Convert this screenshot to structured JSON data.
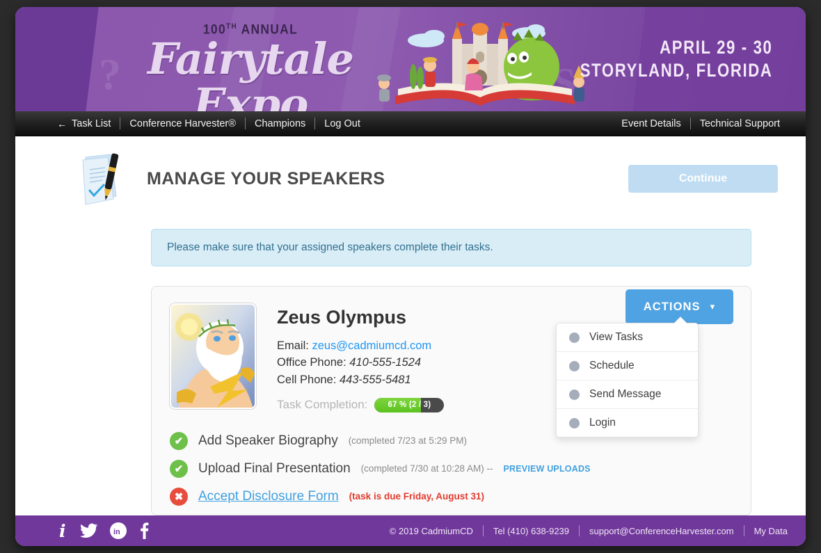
{
  "banner": {
    "annual": "100",
    "annual_sup": "TH",
    "annual_word": "ANNUAL",
    "expo_name": "Fairytale Expo",
    "dates": "APRIL 29 - 30",
    "location": "STORYLAND, FLORIDA",
    "colors": {
      "dark_purple": "#6b3a96",
      "light_purple": "#8e5bb0"
    }
  },
  "nav": {
    "back_arrow": "←",
    "left": [
      {
        "label": "Task List"
      },
      {
        "label": "Conference Harvester®"
      },
      {
        "label": "Champions"
      },
      {
        "label": "Log Out"
      }
    ],
    "right": [
      {
        "label": "Event Details"
      },
      {
        "label": "Technical Support"
      }
    ]
  },
  "header": {
    "title": "MANAGE YOUR SPEAKERS",
    "continue_label": "Continue",
    "continue_color": "#bfdcf2",
    "doc_icon": "document-pen-icon"
  },
  "alert": {
    "message": "Please make sure that your assigned speakers complete their tasks."
  },
  "speaker": {
    "avatar_alt": "zeus-avatar",
    "name": "Zeus Olympus",
    "email_label": "Email:",
    "email": "zeus@cadmiumcd.com",
    "office_label": "Office Phone:",
    "office_phone": "410-555-1524",
    "cell_label": "Cell Phone:",
    "cell_phone": "443-555-5481",
    "completion_label": "Task Completion:",
    "completion_text": "67 % (2 / 3)",
    "completion_percent": 67,
    "progress_fill_color": "#5bc320",
    "progress_track_color": "#4a4a4a"
  },
  "actions": {
    "button_label": "ACTIONS",
    "chevron": "⌄",
    "button_color": "#4fa3e3",
    "menu": [
      {
        "label": "View Tasks"
      },
      {
        "label": "Schedule"
      },
      {
        "label": "Send Message"
      },
      {
        "label": "Login"
      }
    ]
  },
  "tasks": [
    {
      "status": "done",
      "icon": "check-circle-icon",
      "glyph": "✔",
      "name": "Add Speaker Biography",
      "meta": "(completed 7/23 at 5:29 PM)",
      "link": ""
    },
    {
      "status": "done",
      "icon": "check-circle-icon",
      "glyph": "✔",
      "name": "Upload Final Presentation",
      "meta": "(completed 7/30 at 10:28 AM) --",
      "link": "PREVIEW UPLOADS"
    },
    {
      "status": "todo",
      "icon": "x-circle-icon",
      "glyph": "✖",
      "name": "Accept Disclosure Form",
      "meta": "(task is due Friday, August 31)",
      "link": ""
    }
  ],
  "footer": {
    "social": [
      {
        "name": "info-icon",
        "glyph": "i"
      },
      {
        "name": "twitter-icon",
        "glyph": "🐦"
      },
      {
        "name": "linkedin-icon",
        "glyph": "in"
      },
      {
        "name": "facebook-icon",
        "glyph": "f"
      }
    ],
    "copyright": "© 2019 CadmiumCD",
    "tel": "Tel (410) 638-9239",
    "support_email": "support@ConferenceHarvester.com",
    "my_data": "My Data",
    "bg_color": "#70389b"
  }
}
